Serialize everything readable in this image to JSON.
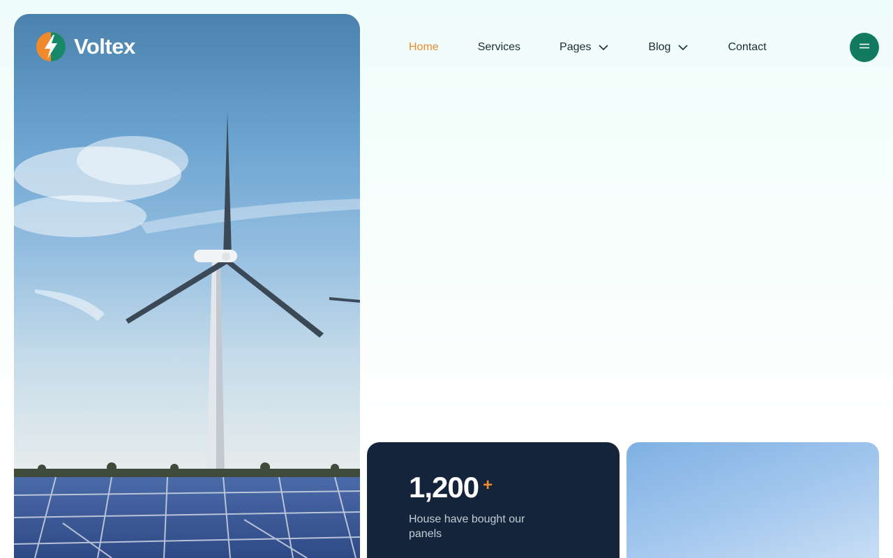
{
  "brand": {
    "name": "Voltex",
    "logo_icon": "lightning-globe-icon",
    "accent": "#f08a2c",
    "primary": "#127a5f",
    "dark": "#14243a"
  },
  "nav": {
    "items": [
      {
        "label": "Home",
        "active": true,
        "has_dropdown": false
      },
      {
        "label": "Services",
        "active": false,
        "has_dropdown": false
      },
      {
        "label": "Pages",
        "active": false,
        "has_dropdown": true
      },
      {
        "label": "Blog",
        "active": false,
        "has_dropdown": true
      },
      {
        "label": "Contact",
        "active": false,
        "has_dropdown": false
      }
    ],
    "menu_icon": "hamburger-icon"
  },
  "stats": {
    "number": "1,200",
    "suffix": "+",
    "caption": "House have bought our panels"
  }
}
